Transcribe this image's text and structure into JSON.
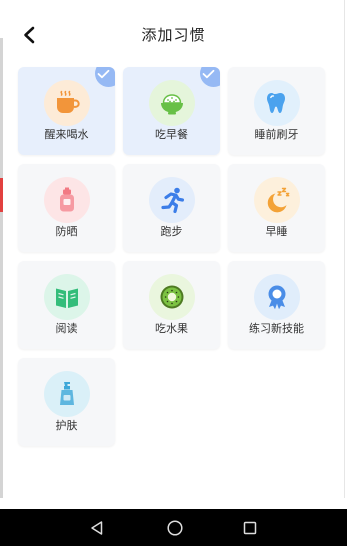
{
  "header": {
    "back_icon": "chevron-left-icon",
    "title": "添加习惯"
  },
  "habits": [
    {
      "label": "醒来喝水",
      "icon": "cup-icon",
      "selected": true,
      "icon_bg": "#fdebd7",
      "icon_color": "#f2953a"
    },
    {
      "label": "吃早餐",
      "icon": "rice-bowl-icon",
      "selected": true,
      "icon_bg": "#e5f5db",
      "icon_color": "#68c047"
    },
    {
      "label": "睡前刷牙",
      "icon": "tooth-icon",
      "selected": false,
      "icon_bg": "#e1f0fc",
      "icon_color": "#4aa2ee"
    },
    {
      "label": "防晒",
      "icon": "sunscreen-bottle-icon",
      "selected": false,
      "icon_bg": "#fde5e6",
      "icon_color": "#f27a84"
    },
    {
      "label": "跑步",
      "icon": "running-man-icon",
      "selected": false,
      "icon_bg": "#e3edfb",
      "icon_color": "#3b7de8"
    },
    {
      "label": "早睡",
      "icon": "moon-zzz-icon",
      "selected": false,
      "icon_bg": "#fdf0dc",
      "icon_color": "#f3a237"
    },
    {
      "label": "阅读",
      "icon": "open-book-icon",
      "selected": false,
      "icon_bg": "#dcf5e9",
      "icon_color": "#33bd7a"
    },
    {
      "label": "吃水果",
      "icon": "kiwi-icon",
      "selected": false,
      "icon_bg": "#eaf6de",
      "icon_color": "#7cc242"
    },
    {
      "label": "练习新技能",
      "icon": "ribbon-badge-icon",
      "selected": false,
      "icon_bg": "#e0edfb",
      "icon_color": "#4a8de7"
    },
    {
      "label": "护肤",
      "icon": "lotion-bottle-icon",
      "selected": false,
      "icon_bg": "#daf0f8",
      "icon_color": "#3ea8d8"
    }
  ],
  "selected_badge_icon": "check-icon",
  "colors": {
    "card_bg": "#f6f7f9",
    "card_selected_bg": "#e7effc",
    "badge_bg": "#96b9f4",
    "label_text": "#333333",
    "title_text": "#222222",
    "nav_bar_bg": "#000000"
  },
  "nav_bar": {
    "back_icon": "back-triangle-icon",
    "home_icon": "home-circle-icon",
    "recent_icon": "recent-square-icon"
  }
}
